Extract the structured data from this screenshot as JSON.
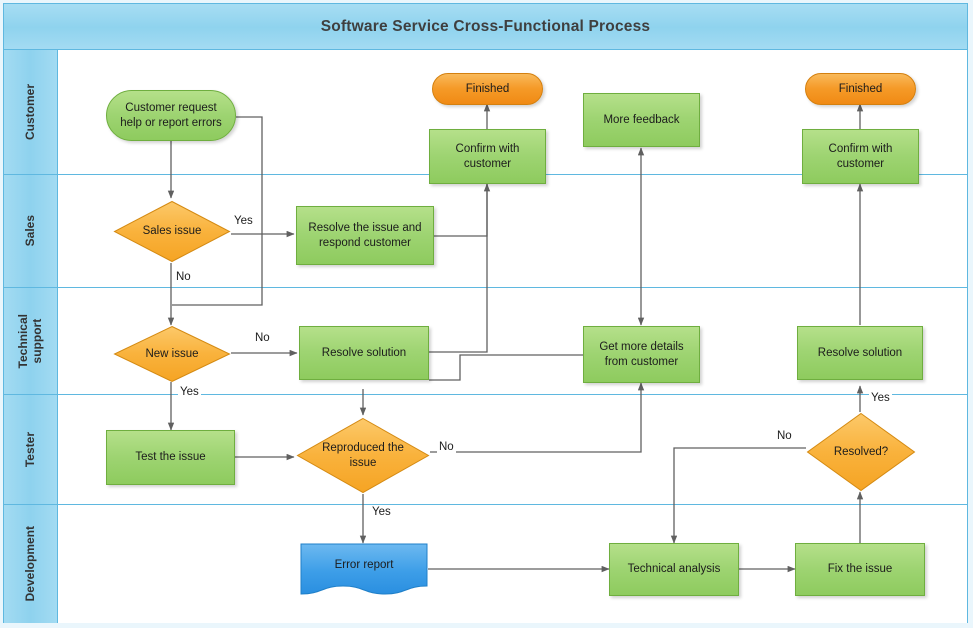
{
  "header": {
    "title": "Software Service Cross-Functional Process"
  },
  "colors": {
    "banner": "#8fd3ee",
    "lane_header": "#8ed2ee",
    "lane_border": "#5fb8e0",
    "process_fill": "#9ed472",
    "process_border": "#6fae3f",
    "decision_fill": "#f9b23c",
    "decision_border": "#d48a12",
    "terminator_fill": "#f59a28",
    "terminator_border": "#d4800f",
    "document_fill": "#3d9ee8",
    "document_border": "#1f7fc8",
    "connector": "#606060",
    "page_background": "#eaf6fc"
  },
  "lanes": [
    {
      "id": "customer",
      "label": "Customer"
    },
    {
      "id": "sales",
      "label": "Sales"
    },
    {
      "id": "tech",
      "label": "Technical\nsupport"
    },
    {
      "id": "tester",
      "label": "Tester"
    },
    {
      "id": "dev",
      "label": "Development"
    }
  ],
  "nodes": [
    {
      "id": "start",
      "lane": "customer",
      "shape": "start",
      "label": "Customer request\nhelp or report errors"
    },
    {
      "id": "finished1",
      "lane": "customer",
      "shape": "terminator",
      "label": "Finished"
    },
    {
      "id": "confirm1",
      "lane": "customer",
      "shape": "process",
      "label": "Confirm with\ncustomer"
    },
    {
      "id": "morefeedback",
      "lane": "customer",
      "shape": "process",
      "label": "More feedback"
    },
    {
      "id": "finished2",
      "lane": "customer",
      "shape": "terminator",
      "label": "Finished"
    },
    {
      "id": "confirm2",
      "lane": "customer",
      "shape": "process",
      "label": "Confirm with\ncustomer"
    },
    {
      "id": "salesissue",
      "lane": "sales",
      "shape": "decision",
      "label": "Sales issue"
    },
    {
      "id": "resolveresp",
      "lane": "sales",
      "shape": "process",
      "label": "Resolve the issue and\nrespond customer"
    },
    {
      "id": "newissue",
      "lane": "tech",
      "shape": "decision",
      "label": "New issue"
    },
    {
      "id": "resolvesol1",
      "lane": "tech",
      "shape": "process",
      "label": "Resolve solution"
    },
    {
      "id": "getdetails",
      "lane": "tech",
      "shape": "process",
      "label": "Get more details\nfrom customer"
    },
    {
      "id": "resolvesol2",
      "lane": "tech",
      "shape": "process",
      "label": "Resolve solution"
    },
    {
      "id": "testissue",
      "lane": "tester",
      "shape": "process",
      "label": "Test the issue"
    },
    {
      "id": "reproduced",
      "lane": "tester",
      "shape": "decision",
      "label": "Reproduced the\nissue"
    },
    {
      "id": "resolved",
      "lane": "tester",
      "shape": "decision",
      "label": "Resolved?"
    },
    {
      "id": "errorreport",
      "lane": "dev",
      "shape": "document",
      "label": "Error report"
    },
    {
      "id": "techanalysis",
      "lane": "dev",
      "shape": "process",
      "label": "Technical analysis"
    },
    {
      "id": "fixissue",
      "lane": "dev",
      "shape": "process",
      "label": "Fix the issue"
    }
  ],
  "edge_labels": [
    {
      "id": "sales-yes",
      "text": "Yes"
    },
    {
      "id": "sales-no",
      "text": "No"
    },
    {
      "id": "newissue-no",
      "text": "No"
    },
    {
      "id": "newissue-yes",
      "text": "Yes"
    },
    {
      "id": "repro-no",
      "text": "No"
    },
    {
      "id": "repro-yes",
      "text": "Yes"
    },
    {
      "id": "resolved-no",
      "text": "No"
    },
    {
      "id": "resolved-yes",
      "text": "Yes"
    }
  ],
  "flows": [
    {
      "from": "start",
      "to": "salesissue",
      "label": ""
    },
    {
      "from": "start",
      "to": "newissue",
      "label": ""
    },
    {
      "from": "salesissue",
      "to": "resolveresp",
      "label": "Yes"
    },
    {
      "from": "salesissue",
      "to": "newissue",
      "label": "No"
    },
    {
      "from": "resolveresp",
      "to": "confirm1",
      "label": ""
    },
    {
      "from": "confirm1",
      "to": "finished1",
      "label": ""
    },
    {
      "from": "newissue",
      "to": "resolvesol1",
      "label": "No"
    },
    {
      "from": "newissue",
      "to": "testissue",
      "label": "Yes"
    },
    {
      "from": "resolvesol1",
      "to": "confirm1",
      "label": ""
    },
    {
      "from": "resolvesol1",
      "to": "getdetails",
      "label": ""
    },
    {
      "from": "testissue",
      "to": "reproduced",
      "label": ""
    },
    {
      "from": "reproduced",
      "to": "getdetails",
      "label": "No"
    },
    {
      "from": "reproduced",
      "to": "errorreport",
      "label": "Yes"
    },
    {
      "from": "getdetails",
      "to": "morefeedback",
      "label": ""
    },
    {
      "from": "morefeedback",
      "to": "getdetails",
      "label": ""
    },
    {
      "from": "errorreport",
      "to": "techanalysis",
      "label": ""
    },
    {
      "from": "techanalysis",
      "to": "fixissue",
      "label": ""
    },
    {
      "from": "fixissue",
      "to": "resolved",
      "label": ""
    },
    {
      "from": "resolved",
      "to": "resolvesol2",
      "label": "Yes"
    },
    {
      "from": "resolved",
      "to": "techanalysis",
      "label": "No"
    },
    {
      "from": "resolvesol2",
      "to": "confirm2",
      "label": ""
    },
    {
      "from": "confirm2",
      "to": "finished2",
      "label": ""
    }
  ]
}
